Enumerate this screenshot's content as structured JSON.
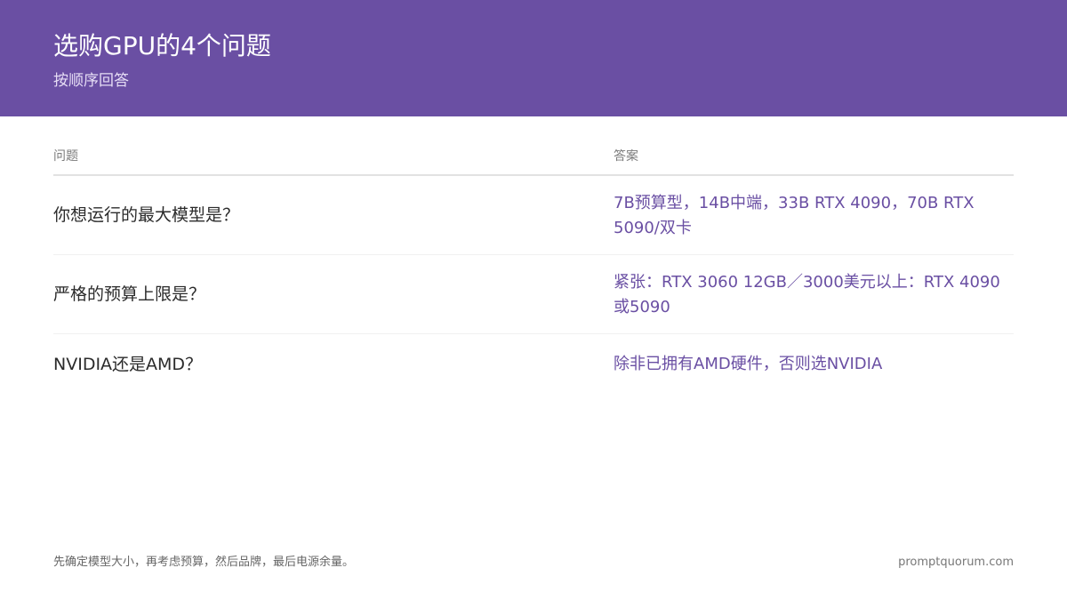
{
  "header": {
    "title": "选购GPU的4个问题",
    "subtitle": "按顺序回答"
  },
  "table": {
    "columns": {
      "question": "问题",
      "answer": "答案"
    },
    "rows": [
      {
        "question": "你想运行的最大模型是？",
        "answer": "7B预算型，14B中端，33B RTX 4090，70B RTX 5090/双卡"
      },
      {
        "question": "严格的预算上限是？",
        "answer": "紧张：RTX 3060 12GB／3000美元以上：RTX 4090或5090"
      },
      {
        "question": "NVIDIA还是AMD？",
        "answer": "除非已拥有AMD硬件，否则选NVIDIA"
      }
    ]
  },
  "footer": {
    "note": "先确定模型大小，再考虑预算，然后品牌，最后电源余量。",
    "site": "promptquorum.com"
  },
  "colors": {
    "header_bg": "#6a4fa3",
    "answer_text": "#6a4fa3"
  }
}
